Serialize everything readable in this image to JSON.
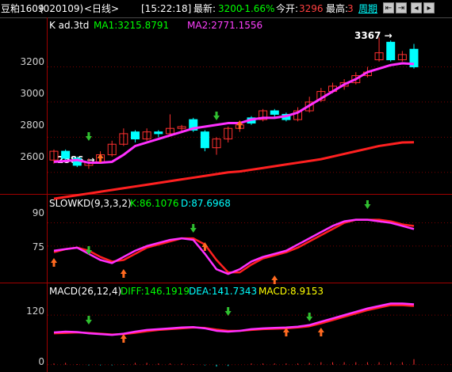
{
  "topbar": {
    "symbol": "豆粕1609",
    "code": "(020109)",
    "period": "<日线>",
    "time": "[15:22:18]",
    "latest_label": "最新:",
    "latest_value": "3200",
    "change_pct": "-1.66%",
    "open_label": "今开:",
    "open_value": "3296",
    "high_label": "最高:",
    "high_value": "3",
    "period_link": "周期",
    "nav_icons": [
      "back-arrow-icon",
      "forward-arrow-icon",
      "left-arrow-icon",
      "right-arrow-icon"
    ],
    "colors": {
      "up": "#ff3030",
      "down": "#00ff00",
      "accent": "#00ffff"
    }
  },
  "main_panel": {
    "indicator_name": "K  ad.3td",
    "ma1_label": "MA1:3215.8791",
    "ma2_label": "MA2:2771.1556",
    "y_ticks": [
      "3200",
      "3000",
      "2800",
      "2600"
    ],
    "annotations": {
      "high": "3367 →",
      "low": "2586 →"
    }
  },
  "kd_panel": {
    "indicator_name": "SLOWKD(9,3,3,2)",
    "k_label": "K:86.1076",
    "d_label": "D:87.6968",
    "y_ticks": [
      "90",
      "75"
    ]
  },
  "macd_panel": {
    "indicator_name": "MACD(26,12,4)",
    "diff_label": "DIFF:146.1919",
    "dea_label": "DEA:141.7343",
    "macd_label": "MACD:8.9153",
    "y_ticks": [
      "120",
      "0"
    ]
  },
  "chart_data": {
    "type": "candlestick",
    "price_ylim": [
      2500,
      3400
    ],
    "candles": [
      {
        "o": 2670,
        "c": 2720,
        "h": 2730,
        "l": 2650
      },
      {
        "o": 2720,
        "c": 2680,
        "h": 2730,
        "l": 2670
      },
      {
        "o": 2680,
        "c": 2640,
        "h": 2690,
        "l": 2630
      },
      {
        "o": 2640,
        "c": 2660,
        "h": 2680,
        "l": 2620
      },
      {
        "o": 2660,
        "c": 2700,
        "h": 2720,
        "l": 2650
      },
      {
        "o": 2700,
        "c": 2760,
        "h": 2780,
        "l": 2690
      },
      {
        "o": 2760,
        "c": 2820,
        "h": 2850,
        "l": 2750
      },
      {
        "o": 2830,
        "c": 2790,
        "h": 2840,
        "l": 2770
      },
      {
        "o": 2790,
        "c": 2830,
        "h": 2850,
        "l": 2780
      },
      {
        "o": 2830,
        "c": 2820,
        "h": 2840,
        "l": 2800
      },
      {
        "o": 2820,
        "c": 2850,
        "h": 2930,
        "l": 2810
      },
      {
        "o": 2850,
        "c": 2860,
        "h": 2870,
        "l": 2830
      },
      {
        "o": 2900,
        "c": 2840,
        "h": 2910,
        "l": 2830
      },
      {
        "o": 2830,
        "c": 2740,
        "h": 2840,
        "l": 2720
      },
      {
        "o": 2740,
        "c": 2790,
        "h": 2800,
        "l": 2700
      },
      {
        "o": 2790,
        "c": 2850,
        "h": 2860,
        "l": 2770
      },
      {
        "o": 2850,
        "c": 2870,
        "h": 2890,
        "l": 2830
      },
      {
        "o": 2910,
        "c": 2880,
        "h": 2920,
        "l": 2870
      },
      {
        "o": 2900,
        "c": 2950,
        "h": 2960,
        "l": 2890
      },
      {
        "o": 2950,
        "c": 2930,
        "h": 2960,
        "l": 2910
      },
      {
        "o": 2930,
        "c": 2900,
        "h": 2940,
        "l": 2890
      },
      {
        "o": 2900,
        "c": 2950,
        "h": 2970,
        "l": 2890
      },
      {
        "o": 2950,
        "c": 3000,
        "h": 3030,
        "l": 2940
      },
      {
        "o": 3010,
        "c": 3060,
        "h": 3080,
        "l": 3000
      },
      {
        "o": 3060,
        "c": 3090,
        "h": 3110,
        "l": 3050
      },
      {
        "o": 3090,
        "c": 3110,
        "h": 3130,
        "l": 3070
      },
      {
        "o": 3110,
        "c": 3150,
        "h": 3170,
        "l": 3100
      },
      {
        "o": 3150,
        "c": 3170,
        "h": 3200,
        "l": 3140
      },
      {
        "o": 3240,
        "c": 3280,
        "h": 3367,
        "l": 3230
      },
      {
        "o": 3340,
        "c": 3240,
        "h": 3350,
        "l": 3230
      },
      {
        "o": 3240,
        "c": 3270,
        "h": 3290,
        "l": 3230
      },
      {
        "o": 3300,
        "c": 3200,
        "h": 3330,
        "l": 3190
      }
    ],
    "ma1": [
      2660,
      2665,
      2670,
      2655,
      2655,
      2660,
      2700,
      2750,
      2770,
      2790,
      2810,
      2830,
      2850,
      2860,
      2870,
      2880,
      2880,
      2900,
      2910,
      2910,
      2920,
      2940,
      2980,
      3020,
      3060,
      3100,
      3130,
      3170,
      3190,
      3210,
      3220,
      3216
    ],
    "ma2": [
      2450,
      2460,
      2470,
      2480,
      2490,
      2500,
      2510,
      2520,
      2530,
      2540,
      2550,
      2560,
      2570,
      2580,
      2590,
      2600,
      2605,
      2615,
      2625,
      2635,
      2645,
      2655,
      2665,
      2675,
      2690,
      2705,
      2720,
      2735,
      2750,
      2760,
      2770,
      2771
    ],
    "kd_ylim": [
      55,
      100
    ],
    "k": [
      72,
      73,
      74,
      70,
      66,
      64,
      68,
      72,
      75,
      77,
      79,
      80,
      79,
      70,
      60,
      57,
      60,
      65,
      68,
      70,
      72,
      76,
      80,
      84,
      88,
      91,
      92,
      92,
      91,
      90,
      88,
      86
    ],
    "d": [
      71,
      73,
      74,
      72,
      68,
      65,
      66,
      70,
      74,
      76,
      78,
      80,
      80,
      76,
      66,
      58,
      58,
      63,
      67,
      69,
      71,
      74,
      78,
      82,
      86,
      90,
      92,
      92,
      92,
      91,
      89,
      88
    ],
    "macd_ylim": [
      -10,
      170
    ],
    "diff": [
      78,
      80,
      79,
      76,
      74,
      72,
      75,
      80,
      84,
      86,
      88,
      90,
      91,
      88,
      82,
      80,
      82,
      86,
      88,
      89,
      90,
      92,
      96,
      104,
      112,
      120,
      128,
      136,
      142,
      148,
      148,
      146
    ],
    "dea": [
      76,
      77,
      78,
      77,
      75,
      73,
      74,
      77,
      81,
      84,
      86,
      88,
      90,
      89,
      85,
      82,
      82,
      84,
      86,
      87,
      88,
      90,
      93,
      100,
      108,
      116,
      124,
      132,
      138,
      144,
      144,
      142
    ],
    "macd_hist": [
      2,
      3,
      1,
      -1,
      -1,
      -1,
      1,
      3,
      3,
      2,
      2,
      2,
      1,
      -1,
      -3,
      -2,
      0,
      2,
      2,
      2,
      2,
      2,
      3,
      4,
      4,
      4,
      4,
      4,
      4,
      4,
      4,
      9
    ]
  }
}
